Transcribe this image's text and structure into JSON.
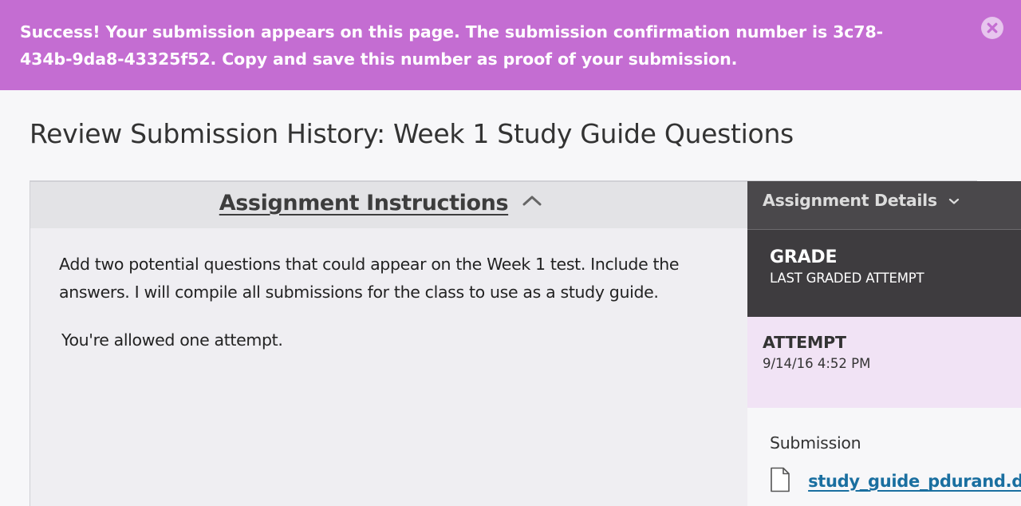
{
  "banner": {
    "message": "Success! Your submission appears on this page. The submission confirmation number is 3c78-434b-9da8-43325f52. Copy and save this number as proof of your submission.",
    "close_icon": "close-circle-icon",
    "background": "#c46dd2"
  },
  "page": {
    "title": "Review Submission History: Week 1 Study Guide Questions"
  },
  "instructions": {
    "header": "Assignment Instructions",
    "toggle_icon": "chevron-up-icon",
    "text": "Add two potential questions that could appear on the Week 1 test. Include the answers. I will compile all submissions for the class to use as a study guide.",
    "attempts_note": "You're allowed one attempt."
  },
  "details": {
    "header": "Assignment Details",
    "toggle_icon": "chevron-down-icon",
    "grade": {
      "title": "GRADE",
      "subtitle": "LAST GRADED ATTEMPT"
    },
    "attempt": {
      "title": "ATTEMPT",
      "date": "9/14/16 4:52 PM",
      "highlight": "#f1e3f5"
    },
    "submission": {
      "label": "Submission",
      "file_icon": "document-icon",
      "file_name": "study_guide_pdurand.docx"
    }
  }
}
